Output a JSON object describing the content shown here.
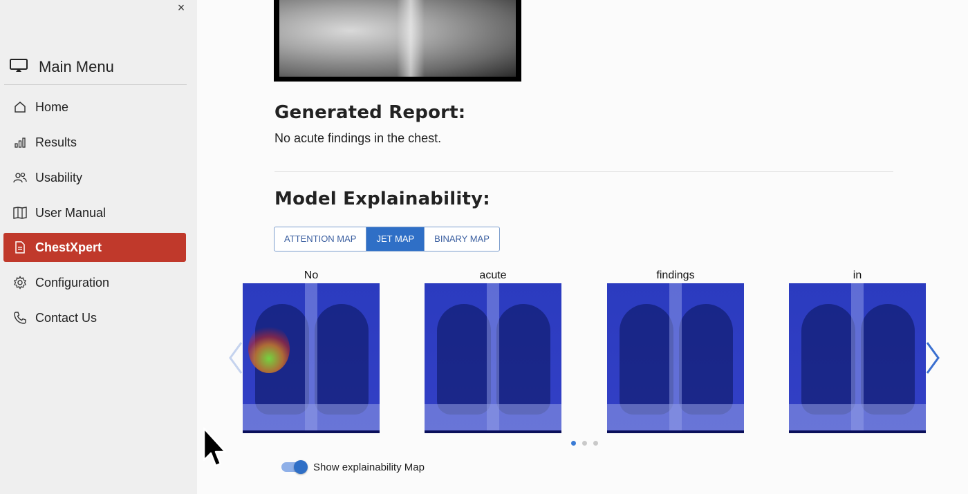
{
  "sidebar": {
    "close_label": "×",
    "title": "Main Menu",
    "items": [
      {
        "label": "Home",
        "icon": "home-icon"
      },
      {
        "label": "Results",
        "icon": "bar-chart-icon"
      },
      {
        "label": "Usability",
        "icon": "users-icon"
      },
      {
        "label": "User Manual",
        "icon": "book-icon"
      },
      {
        "label": "ChestXpert",
        "icon": "document-icon",
        "active": true
      },
      {
        "label": "Configuration",
        "icon": "gear-icon"
      },
      {
        "label": "Contact Us",
        "icon": "phone-icon"
      }
    ]
  },
  "main": {
    "report_title": "Generated Report:",
    "report_text": "No acute findings in the chest.",
    "explain_title": "Model Explainability:",
    "tabs": [
      {
        "label": "ATTENTION MAP"
      },
      {
        "label": "JET MAP",
        "active": true
      },
      {
        "label": "BINARY MAP"
      }
    ],
    "carousel": {
      "words": [
        "No",
        "acute",
        "findings",
        "in"
      ],
      "page_count": 3,
      "active_page": 1
    },
    "toggle": {
      "label": "Show explainability Map",
      "on": true
    }
  },
  "colors": {
    "active_nav": "#c0392b",
    "accent": "#2f6fc6",
    "jet_base": "#2b3bbf"
  }
}
